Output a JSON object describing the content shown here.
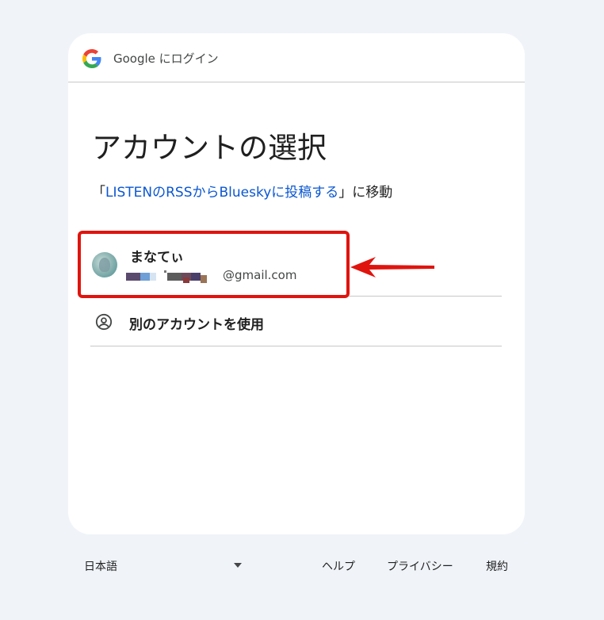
{
  "header": {
    "text": "Google にログイン",
    "logo_icon": "google-g-icon"
  },
  "title": "アカウントの選択",
  "subtitle": {
    "open_quote": "「",
    "app_name": "LISTENのRSSからBlueskyに投稿する",
    "close_text": "」に移動"
  },
  "account": {
    "name": "まなてぃ",
    "email_suffix": "@gmail.com",
    "avatar_icon": "avatar"
  },
  "other_account": {
    "label": "別のアカウントを使用",
    "icon": "person-circle-icon"
  },
  "footer": {
    "language": "日本語",
    "help": "ヘルプ",
    "privacy": "プライバシー",
    "terms": "規約"
  },
  "colors": {
    "background": "#f0f4f9",
    "link": "#0b57d0",
    "annotation_red": "#e0140e"
  }
}
